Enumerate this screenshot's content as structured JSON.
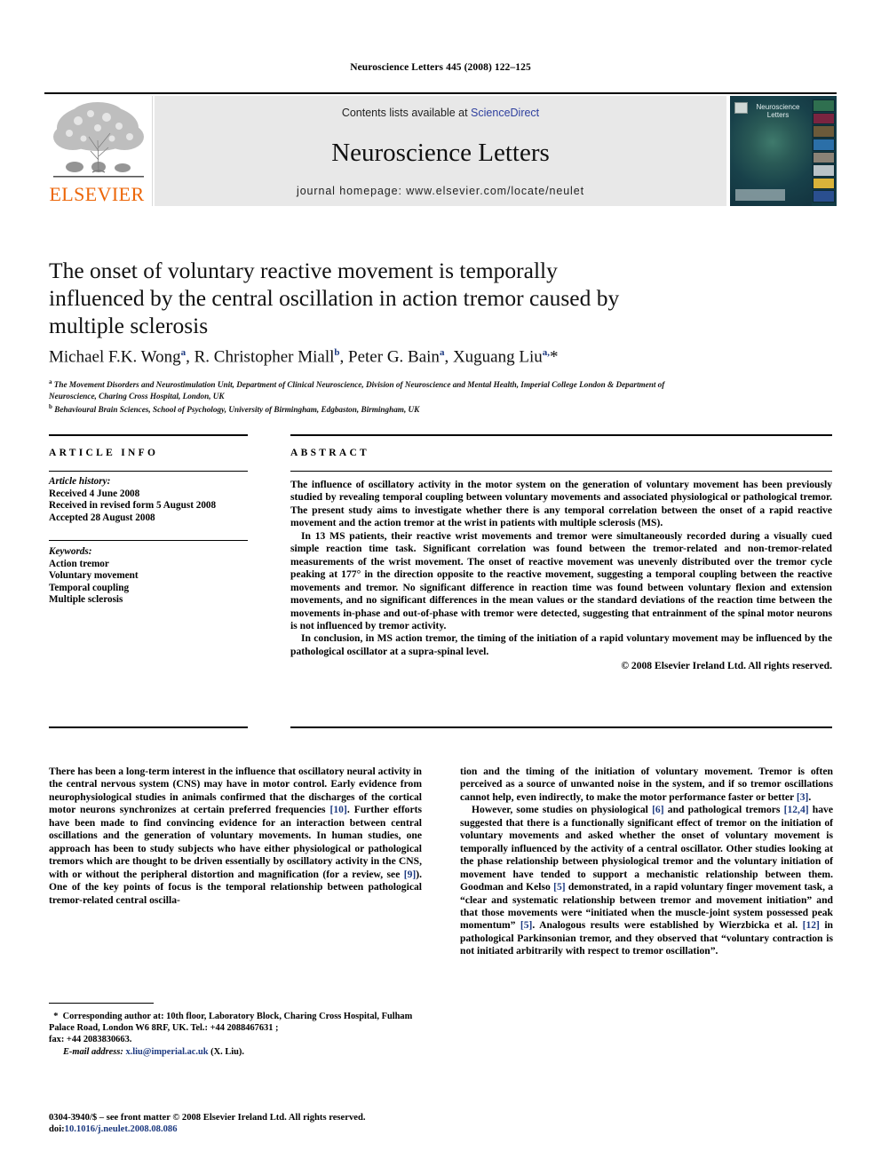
{
  "running_head": "Neuroscience Letters 445 (2008) 122–125",
  "header": {
    "publisher_logo_label": "ELSEVIER",
    "contents_prefix": "Contents lists available at ",
    "contents_link": "ScienceDirect",
    "journal_name": "Neuroscience Letters",
    "homepage": "journal homepage: www.elsevier.com/locate/neulet",
    "cover_title": "Neuroscience Letters"
  },
  "article": {
    "title": "The onset of voluntary reactive movement is temporally influenced by the central oscillation in action tremor caused by multiple sclerosis",
    "authors_html": "Michael F.K. Wong<sup>a</sup>, R. Christopher Miall<sup>b</sup>, Peter G. Bain<sup>a</sup>, Xuguang Liu<sup>a,</sup>*",
    "affiliations": [
      "a The Movement Disorders and Neurostimulation Unit, Department of Clinical Neuroscience, Division of Neuroscience and Mental Health, Imperial College London & Department of Neuroscience, Charing Cross Hospital, London, UK",
      "b Behavioural Brain Sciences, School of Psychology, University of Birmingham, Edgbaston, Birmingham, UK"
    ]
  },
  "info_panel": {
    "heading": "ARTICLE INFO",
    "history_label": "Article history:",
    "history": [
      "Received 4 June 2008",
      "Received in revised form 5 August 2008",
      "Accepted 28 August 2008"
    ],
    "keywords_label": "Keywords:",
    "keywords": [
      "Action tremor",
      "Voluntary movement",
      "Temporal coupling",
      "Multiple sclerosis"
    ]
  },
  "abstract_panel": {
    "heading": "ABSTRACT",
    "paragraphs": [
      "The influence of oscillatory activity in the motor system on the generation of voluntary movement has been previously studied by revealing temporal coupling between voluntary movements and associated physiological or pathological tremor. The present study aims to investigate whether there is any temporal correlation between the onset of a rapid reactive movement and the action tremor at the wrist in patients with multiple sclerosis (MS).",
      "In 13 MS patients, their reactive wrist movements and tremor were simultaneously recorded during a visually cued simple reaction time task. Significant correlation was found between the tremor-related and non-tremor-related measurements of the wrist movement. The onset of reactive movement was unevenly distributed over the tremor cycle peaking at 177° in the direction opposite to the reactive movement, suggesting a temporal coupling between the reactive movements and tremor. No significant difference in reaction time was found between voluntary flexion and extension movements, and no significant differences in the mean values or the standard deviations of the reaction time between the movements in-phase and out-of-phase with tremor were detected, suggesting that entrainment of the spinal motor neurons is not influenced by tremor activity.",
      "In conclusion, in MS action tremor, the timing of the initiation of a rapid voluntary movement may be influenced by the pathological oscillator at a supra-spinal level."
    ],
    "copyright": "© 2008 Elsevier Ireland Ltd. All rights reserved."
  },
  "body": {
    "left_column_paragraph": "There has been a long-term interest in the influence that oscillatory neural activity in the central nervous system (CNS) may have in motor control. Early evidence from neurophysiological studies in animals confirmed that the discharges of the cortical motor neurons synchronizes at certain preferred frequencies [10]. Further efforts have been made to find convincing evidence for an interaction between central oscillations and the generation of voluntary movements. In human studies, one approach has been to study subjects who have either physiological or pathological tremors which are thought to be driven essentially by oscillatory activity in the CNS, with or without the peripheral distortion and magnification (for a review, see [9]). One of the key points of focus is the temporal relationship between pathological tremor-related central oscilla-",
    "right_column_paragraph_1": "tion and the timing of the initiation of voluntary movement. Tremor is often perceived as a source of unwanted noise in the system, and if so tremor oscillations cannot help, even indirectly, to make the motor performance faster or better [3].",
    "right_column_paragraph_2": "However, some studies on physiological [6] and pathological tremors [12,4] have suggested that there is a functionally significant effect of tremor on the initiation of voluntary movements and asked whether the onset of voluntary movement is temporally influenced by the activity of a central oscillator. Other studies looking at the phase relationship between physiological tremor and the voluntary initiation of movement have tended to support a mechanistic relationship between them. Goodman and Kelso [5] demonstrated, in a rapid voluntary finger movement task, a “clear and systematic relationship between tremor and movement initiation” and that those movements were “initiated when the muscle-joint system possessed peak momentum” [5]. Analogous results were established by Wierzbicka et al. [12] in pathological Parkinsonian tremor, and they observed that “voluntary contraction is not initiated arbitrarily with respect to tremor oscillation”."
  },
  "footnote": {
    "corresponding_marker": "*",
    "corresponding_text": "Corresponding author at: 10th floor, Laboratory Block, Charing Cross Hospital, Fulham Palace Road, London W6 8RF, UK. Tel.: +44 2088467631 ;",
    "fax_text": "fax: +44 2083830663.",
    "email_label": "E-mail address:",
    "email": "x.liu@imperial.ac.uk",
    "email_owner": "(X. Liu)."
  },
  "colophon": {
    "issn_line": "0304-3940/$ – see front matter © 2008 Elsevier Ireland Ltd. All rights reserved.",
    "doi_label": "doi:",
    "doi": "10.1016/j.neulet.2008.08.086"
  },
  "colors": {
    "link_blue": "#2e3f9e",
    "reference_blue": "#1d3a80",
    "elsevier_orange": "#ec6608",
    "band_gray": "#e8e8e8"
  }
}
